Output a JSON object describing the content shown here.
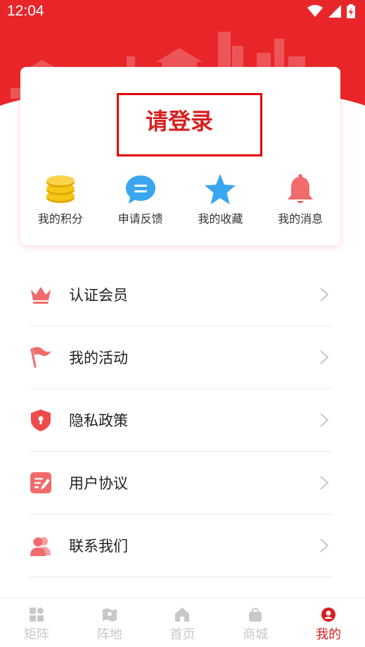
{
  "status": {
    "time": "12:04"
  },
  "card": {
    "login_text": "请登录"
  },
  "quick_actions": [
    {
      "label": "我的积分",
      "icon": "coins-icon"
    },
    {
      "label": "申请反馈",
      "icon": "chat-bubble-icon"
    },
    {
      "label": "我的收藏",
      "icon": "star-icon"
    },
    {
      "label": "我的消息",
      "icon": "bell-icon"
    }
  ],
  "menu": [
    {
      "label": "认证会员",
      "icon": "crown-icon"
    },
    {
      "label": "我的活动",
      "icon": "flag-icon"
    },
    {
      "label": "隐私政策",
      "icon": "shield-icon"
    },
    {
      "label": "用户协议",
      "icon": "document-edit-icon"
    },
    {
      "label": "联系我们",
      "icon": "contacts-icon"
    }
  ],
  "tabs": [
    {
      "label": "矩阵",
      "icon": "grid-icon",
      "active": false
    },
    {
      "label": "阵地",
      "icon": "map-icon",
      "active": false
    },
    {
      "label": "首页",
      "icon": "home-icon",
      "active": false
    },
    {
      "label": "商城",
      "icon": "bag-icon",
      "active": false
    },
    {
      "label": "我的",
      "icon": "user-icon",
      "active": true
    }
  ],
  "colors": {
    "brand_red": "#e8262a",
    "login_border": "#e00000",
    "tab_active": "#d81e1e",
    "tab_inactive": "#c8c8c8",
    "coin_yellow": "#f5c518",
    "bubble_blue": "#3aa6f0",
    "bell_red": "#f26b6b"
  }
}
